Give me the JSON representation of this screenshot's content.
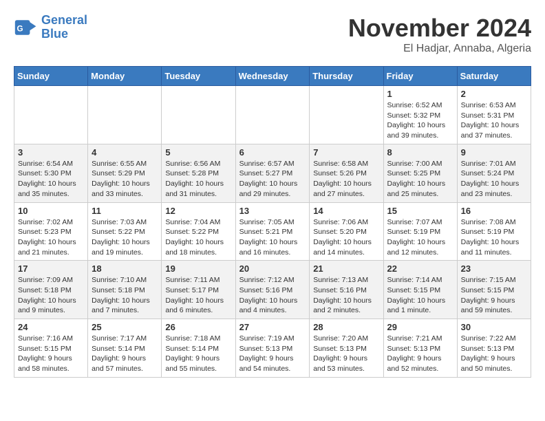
{
  "logo": {
    "line1": "General",
    "line2": "Blue"
  },
  "title": "November 2024",
  "location": "El Hadjar, Annaba, Algeria",
  "headers": [
    "Sunday",
    "Monday",
    "Tuesday",
    "Wednesday",
    "Thursday",
    "Friday",
    "Saturday"
  ],
  "weeks": [
    [
      {
        "day": "",
        "info": ""
      },
      {
        "day": "",
        "info": ""
      },
      {
        "day": "",
        "info": ""
      },
      {
        "day": "",
        "info": ""
      },
      {
        "day": "",
        "info": ""
      },
      {
        "day": "1",
        "info": "Sunrise: 6:52 AM\nSunset: 5:32 PM\nDaylight: 10 hours\nand 39 minutes."
      },
      {
        "day": "2",
        "info": "Sunrise: 6:53 AM\nSunset: 5:31 PM\nDaylight: 10 hours\nand 37 minutes."
      }
    ],
    [
      {
        "day": "3",
        "info": "Sunrise: 6:54 AM\nSunset: 5:30 PM\nDaylight: 10 hours\nand 35 minutes."
      },
      {
        "day": "4",
        "info": "Sunrise: 6:55 AM\nSunset: 5:29 PM\nDaylight: 10 hours\nand 33 minutes."
      },
      {
        "day": "5",
        "info": "Sunrise: 6:56 AM\nSunset: 5:28 PM\nDaylight: 10 hours\nand 31 minutes."
      },
      {
        "day": "6",
        "info": "Sunrise: 6:57 AM\nSunset: 5:27 PM\nDaylight: 10 hours\nand 29 minutes."
      },
      {
        "day": "7",
        "info": "Sunrise: 6:58 AM\nSunset: 5:26 PM\nDaylight: 10 hours\nand 27 minutes."
      },
      {
        "day": "8",
        "info": "Sunrise: 7:00 AM\nSunset: 5:25 PM\nDaylight: 10 hours\nand 25 minutes."
      },
      {
        "day": "9",
        "info": "Sunrise: 7:01 AM\nSunset: 5:24 PM\nDaylight: 10 hours\nand 23 minutes."
      }
    ],
    [
      {
        "day": "10",
        "info": "Sunrise: 7:02 AM\nSunset: 5:23 PM\nDaylight: 10 hours\nand 21 minutes."
      },
      {
        "day": "11",
        "info": "Sunrise: 7:03 AM\nSunset: 5:22 PM\nDaylight: 10 hours\nand 19 minutes."
      },
      {
        "day": "12",
        "info": "Sunrise: 7:04 AM\nSunset: 5:22 PM\nDaylight: 10 hours\nand 18 minutes."
      },
      {
        "day": "13",
        "info": "Sunrise: 7:05 AM\nSunset: 5:21 PM\nDaylight: 10 hours\nand 16 minutes."
      },
      {
        "day": "14",
        "info": "Sunrise: 7:06 AM\nSunset: 5:20 PM\nDaylight: 10 hours\nand 14 minutes."
      },
      {
        "day": "15",
        "info": "Sunrise: 7:07 AM\nSunset: 5:19 PM\nDaylight: 10 hours\nand 12 minutes."
      },
      {
        "day": "16",
        "info": "Sunrise: 7:08 AM\nSunset: 5:19 PM\nDaylight: 10 hours\nand 11 minutes."
      }
    ],
    [
      {
        "day": "17",
        "info": "Sunrise: 7:09 AM\nSunset: 5:18 PM\nDaylight: 10 hours\nand 9 minutes."
      },
      {
        "day": "18",
        "info": "Sunrise: 7:10 AM\nSunset: 5:18 PM\nDaylight: 10 hours\nand 7 minutes."
      },
      {
        "day": "19",
        "info": "Sunrise: 7:11 AM\nSunset: 5:17 PM\nDaylight: 10 hours\nand 6 minutes."
      },
      {
        "day": "20",
        "info": "Sunrise: 7:12 AM\nSunset: 5:16 PM\nDaylight: 10 hours\nand 4 minutes."
      },
      {
        "day": "21",
        "info": "Sunrise: 7:13 AM\nSunset: 5:16 PM\nDaylight: 10 hours\nand 2 minutes."
      },
      {
        "day": "22",
        "info": "Sunrise: 7:14 AM\nSunset: 5:15 PM\nDaylight: 10 hours\nand 1 minute."
      },
      {
        "day": "23",
        "info": "Sunrise: 7:15 AM\nSunset: 5:15 PM\nDaylight: 9 hours\nand 59 minutes."
      }
    ],
    [
      {
        "day": "24",
        "info": "Sunrise: 7:16 AM\nSunset: 5:15 PM\nDaylight: 9 hours\nand 58 minutes."
      },
      {
        "day": "25",
        "info": "Sunrise: 7:17 AM\nSunset: 5:14 PM\nDaylight: 9 hours\nand 57 minutes."
      },
      {
        "day": "26",
        "info": "Sunrise: 7:18 AM\nSunset: 5:14 PM\nDaylight: 9 hours\nand 55 minutes."
      },
      {
        "day": "27",
        "info": "Sunrise: 7:19 AM\nSunset: 5:13 PM\nDaylight: 9 hours\nand 54 minutes."
      },
      {
        "day": "28",
        "info": "Sunrise: 7:20 AM\nSunset: 5:13 PM\nDaylight: 9 hours\nand 53 minutes."
      },
      {
        "day": "29",
        "info": "Sunrise: 7:21 AM\nSunset: 5:13 PM\nDaylight: 9 hours\nand 52 minutes."
      },
      {
        "day": "30",
        "info": "Sunrise: 7:22 AM\nSunset: 5:13 PM\nDaylight: 9 hours\nand 50 minutes."
      }
    ]
  ]
}
